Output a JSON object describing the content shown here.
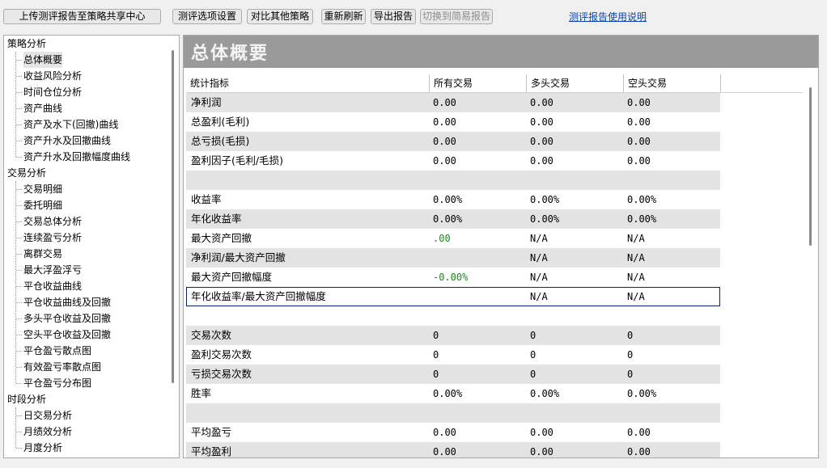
{
  "toolbar": {
    "upload_label": "上传测评报告至策略共享中心",
    "options_label": "测评选项设置",
    "compare_label": "对比其他策略",
    "refresh_label": "重新刷新",
    "export_label": "导出报告",
    "simple_label": "切换到简易报告",
    "help_link": "测评报告使用说明"
  },
  "tree": {
    "groups": [
      {
        "label": "策略分析",
        "items": [
          "总体概要",
          "收益风险分析",
          "时间仓位分析",
          "资产曲线",
          "资产及水下(回撤)曲线",
          "资产升水及回撤曲线",
          "资产升水及回撤幅度曲线"
        ]
      },
      {
        "label": "交易分析",
        "items": [
          "交易明细",
          "委托明细",
          "交易总体分析",
          "连续盈亏分析",
          "离群交易",
          "最大浮盈浮亏",
          "平仓收益曲线",
          "平仓收益曲线及回撤",
          "多头平仓收益及回撤",
          "空头平仓收益及回撤",
          "平仓盈亏散点图",
          "有效盈亏率散点图",
          "平仓盈亏分布图"
        ]
      },
      {
        "label": "时段分析",
        "items": [
          "日交易分析",
          "月绩效分析",
          "月度分析"
        ]
      }
    ],
    "selected": "总体概要"
  },
  "panel": {
    "title": "总体概要",
    "columns": [
      "统计指标",
      "所有交易",
      "多头交易",
      "空头交易"
    ],
    "rows": [
      {
        "label": "净利润",
        "all": "0.00",
        "long": "0.00",
        "short": "0.00"
      },
      {
        "label": "总盈利(毛利)",
        "all": "0.00",
        "long": "0.00",
        "short": "0.00"
      },
      {
        "label": "总亏损(毛损)",
        "all": "0.00",
        "long": "0.00",
        "short": "0.00"
      },
      {
        "label": "盈利因子(毛利/毛损)",
        "all": "0.00",
        "long": "0.00",
        "short": "0.00"
      },
      {
        "label": "",
        "all": "",
        "long": "",
        "short": ""
      },
      {
        "label": "收益率",
        "all": "0.00%",
        "long": "0.00%",
        "short": "0.00%"
      },
      {
        "label": "年化收益率",
        "all": "0.00%",
        "long": "0.00%",
        "short": "0.00%"
      },
      {
        "label": "最大资产回撤",
        "all": ".00",
        "long": "N/A",
        "short": "N/A",
        "all_color": "green"
      },
      {
        "label": "净利润/最大资产回撤",
        "all": "",
        "long": "N/A",
        "short": "N/A"
      },
      {
        "label": "最大资产回撤幅度",
        "all": "-0.00%",
        "long": "N/A",
        "short": "N/A",
        "all_color": "green"
      },
      {
        "label": "年化收益率/最大资产回撤幅度",
        "all": "",
        "long": "N/A",
        "short": "N/A",
        "selected": true
      },
      {
        "label": "",
        "all": "",
        "long": "",
        "short": ""
      },
      {
        "label": "交易次数",
        "all": "0",
        "long": "0",
        "short": "0"
      },
      {
        "label": "盈利交易次数",
        "all": "0",
        "long": "0",
        "short": "0"
      },
      {
        "label": "亏损交易次数",
        "all": "0",
        "long": "0",
        "short": "0"
      },
      {
        "label": "胜率",
        "all": "0.00%",
        "long": "0.00%",
        "short": "0.00%"
      },
      {
        "label": "",
        "all": "",
        "long": "",
        "short": ""
      },
      {
        "label": "平均盈亏",
        "all": "0.00",
        "long": "0.00",
        "short": "0.00"
      },
      {
        "label": "平均盈利",
        "all": "0.00",
        "long": "0.00",
        "short": "0.00"
      }
    ]
  }
}
